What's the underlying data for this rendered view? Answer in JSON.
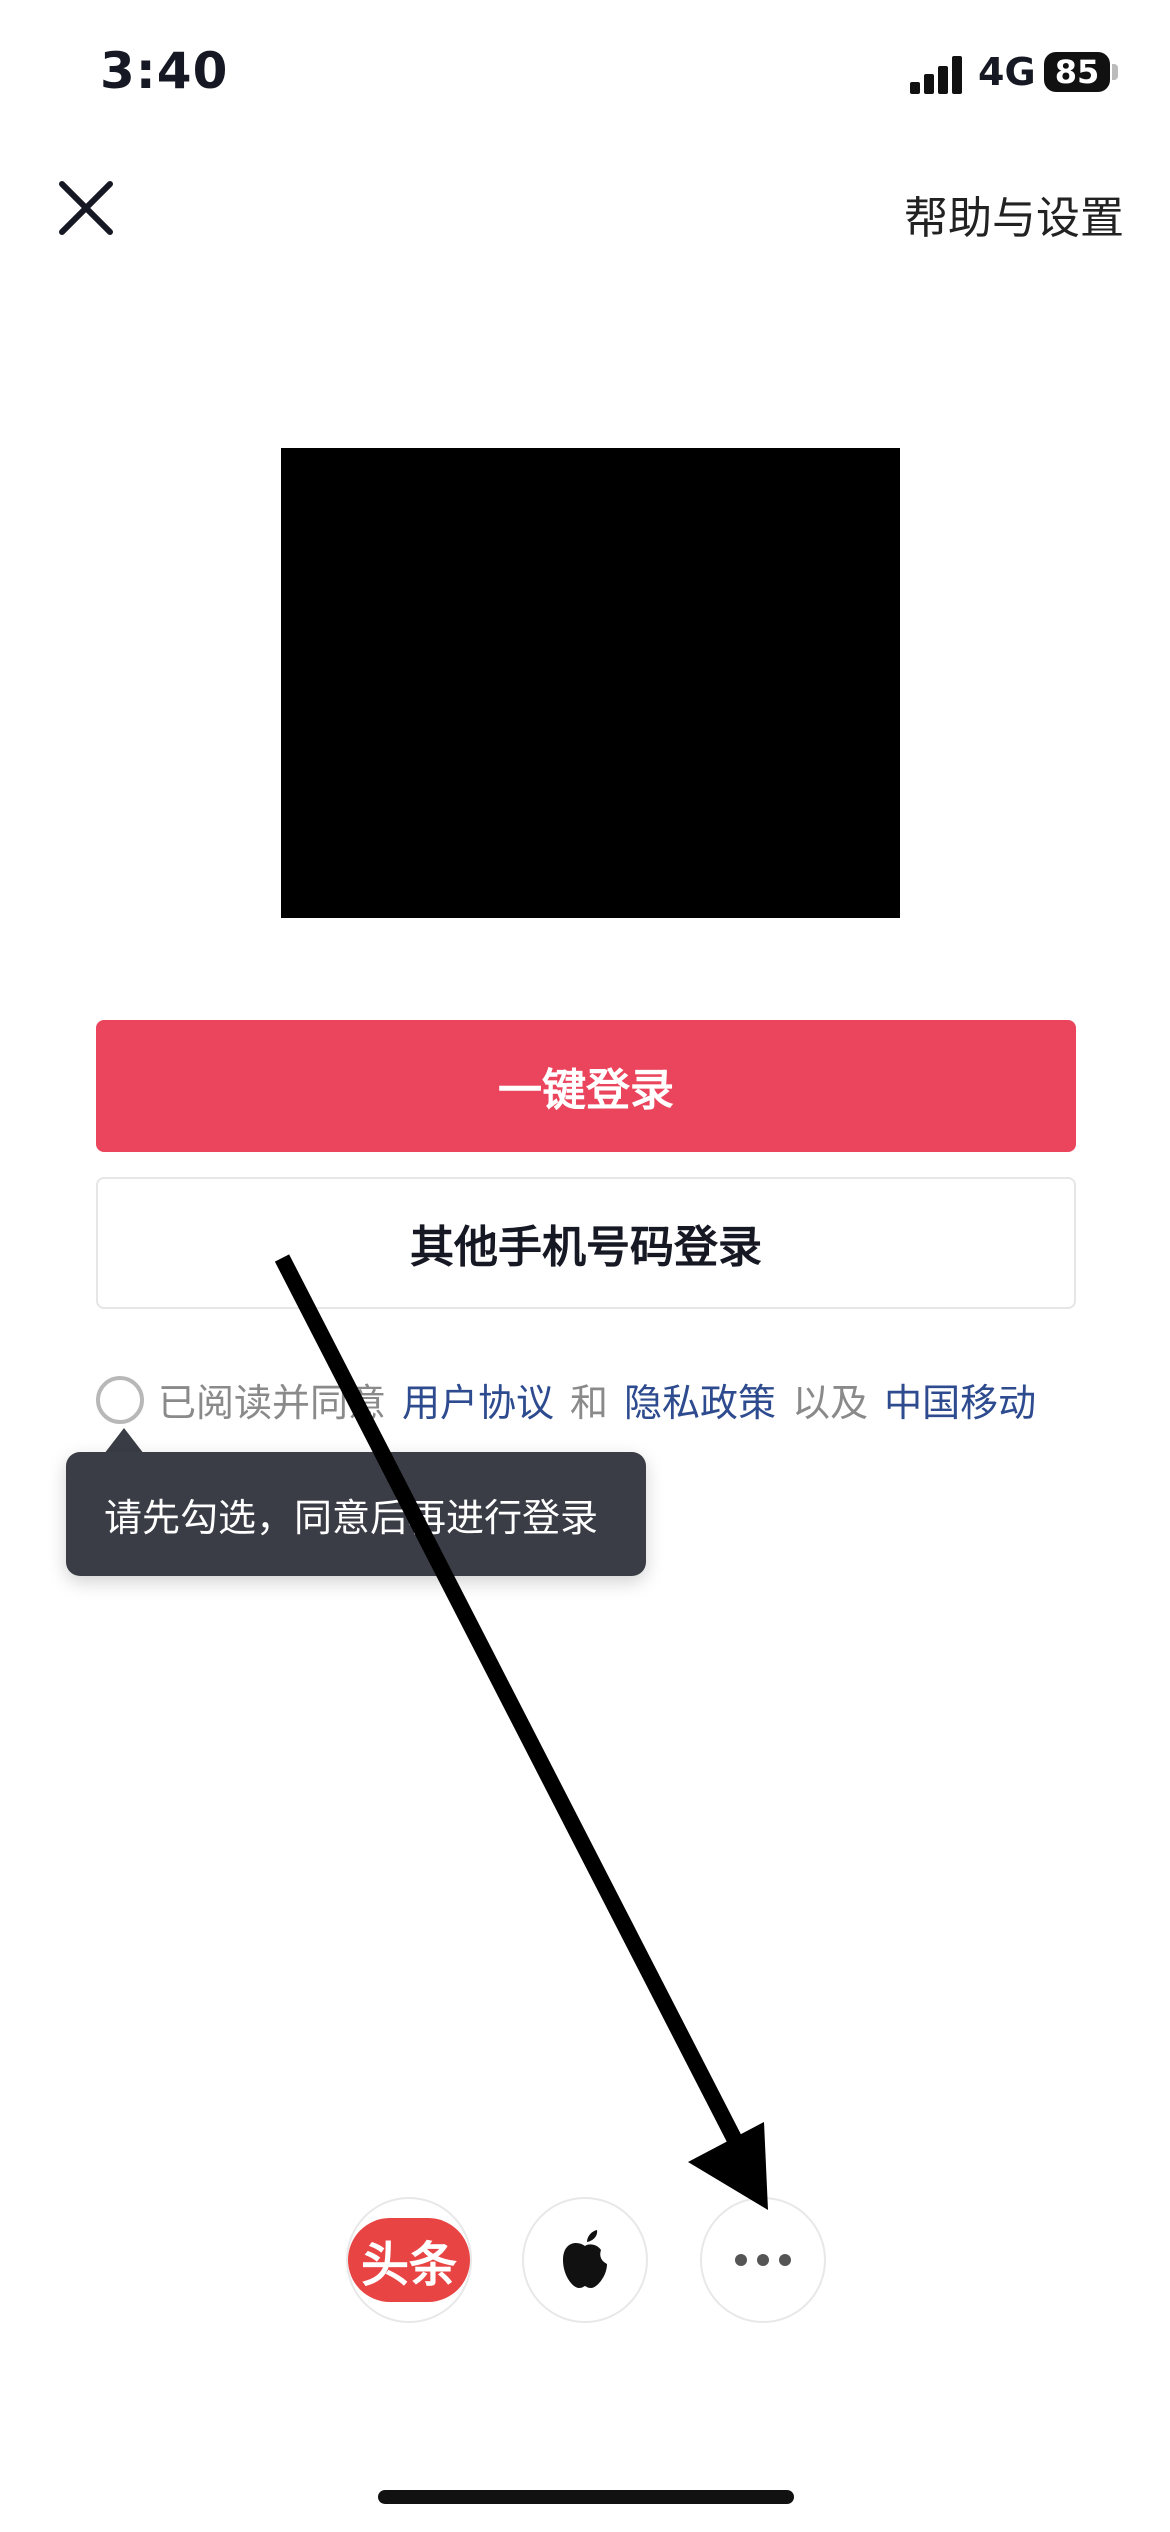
{
  "status_bar": {
    "time": "3:40",
    "network": "4G",
    "battery": "85"
  },
  "header": {
    "close_icon": "close-icon",
    "help_link": "帮助与设置"
  },
  "main": {
    "primary_button": "一键登录",
    "secondary_button": "其他手机号码登录"
  },
  "agreement": {
    "prefix": "已阅读并同意",
    "link_user_agreement": "用户协议",
    "and": "和",
    "link_privacy_policy": "隐私政策",
    "and_also": "以及",
    "link_carrier": "中国移动"
  },
  "tooltip": {
    "text": "请先勾选，同意后再进行登录"
  },
  "login_options": {
    "toutiao_label": "头条",
    "apple_icon": "apple-icon",
    "more_icon": "more-icon"
  },
  "colors": {
    "primary": "#ea455d",
    "link": "#2d4b8e",
    "tooltip_bg": "#3a3d45"
  }
}
